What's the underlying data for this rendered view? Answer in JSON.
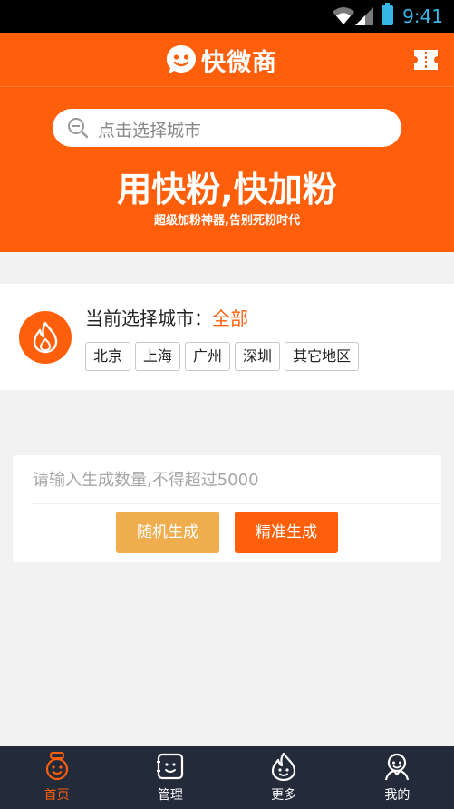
{
  "status_bar": {
    "time": "9:41"
  },
  "header": {
    "app_name": "快微商"
  },
  "banner": {
    "search_placeholder": "点击选择城市",
    "slogan": "用快粉,快加粉",
    "subslogan": "超级加粉神器,告别死粉时代"
  },
  "city": {
    "label": "当前选择城市：",
    "selected": "全部",
    "tags": [
      "北京",
      "上海",
      "广州",
      "深圳",
      "其它地区"
    ]
  },
  "generate": {
    "placeholder": "请输入生成数量,不得超过5000",
    "random_label": "随机生成",
    "precise_label": "精准生成"
  },
  "tabs": [
    {
      "label": "首页",
      "icon": "home-icon",
      "active": true
    },
    {
      "label": "管理",
      "icon": "manage-icon",
      "active": false
    },
    {
      "label": "更多",
      "icon": "more-icon",
      "active": false
    },
    {
      "label": "我的",
      "icon": "profile-icon",
      "active": false
    }
  ],
  "colors": {
    "accent": "#ff5f0a",
    "secondary_button": "#f0ad4e",
    "tabbar": "#232a3a",
    "status_icons": "#36b6e6"
  }
}
